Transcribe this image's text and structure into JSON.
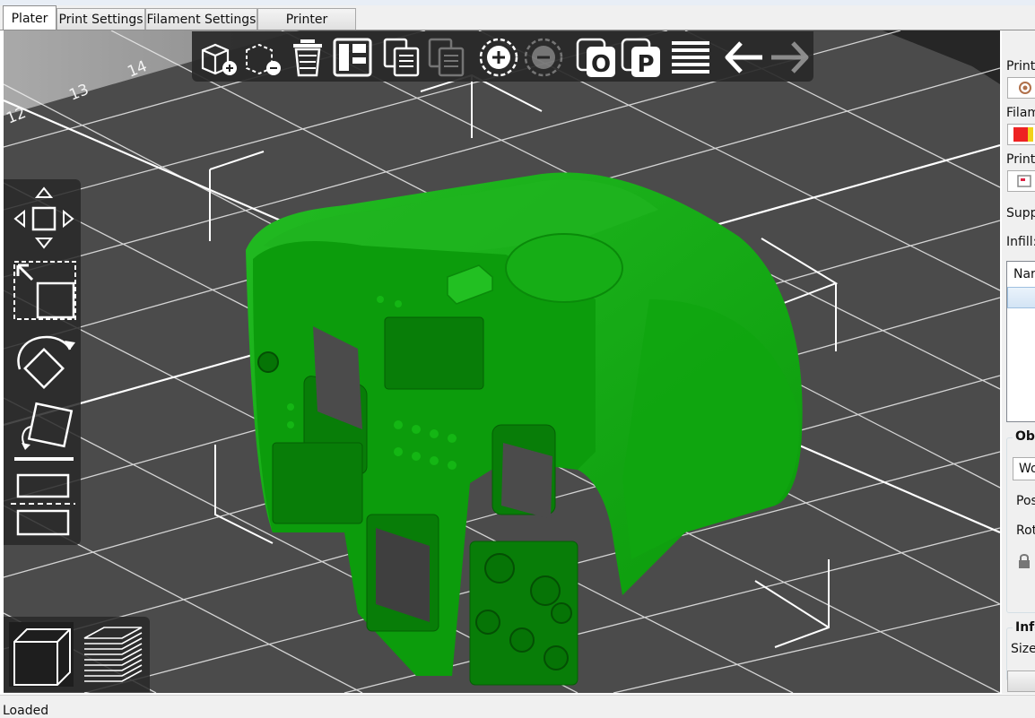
{
  "tabs": [
    {
      "label": "Plater",
      "active": true
    },
    {
      "label": "Print Settings",
      "active": false
    },
    {
      "label": "Filament Settings",
      "active": false
    },
    {
      "label": "Printer Settings",
      "active": false
    }
  ],
  "bed": {
    "grid_labels": [
      "14",
      "13",
      "12"
    ]
  },
  "toolbar": {
    "buttons": [
      {
        "icon": "add-icon",
        "enabled": true
      },
      {
        "icon": "delete-icon",
        "enabled": true
      },
      {
        "icon": "delete-all-icon",
        "enabled": true
      },
      {
        "icon": "arrange-icon",
        "enabled": true
      },
      {
        "icon": "copy-icon",
        "enabled": true
      },
      {
        "icon": "paste-icon",
        "enabled": false
      },
      {
        "icon": "add-instance-icon",
        "enabled": true
      },
      {
        "icon": "remove-instance-icon",
        "enabled": false
      },
      {
        "icon": "split-objects-icon",
        "enabled": true
      },
      {
        "icon": "split-parts-icon",
        "enabled": true
      },
      {
        "icon": "layers-editing-icon",
        "enabled": true
      },
      {
        "icon": "undo-icon",
        "enabled": true
      },
      {
        "icon": "redo-icon",
        "enabled": false
      }
    ],
    "split_objects_letter": "O",
    "split_parts_letter": "P"
  },
  "gizmos": [
    "move-icon",
    "scale-icon",
    "rotate-icon",
    "place-on-face-icon",
    "cut-icon"
  ],
  "view_toolbar": [
    "3d-view-icon",
    "preview-layers-icon"
  ],
  "sidebar": {
    "print_label": "Print",
    "filament_label": "Filam",
    "printer_label": "Printe",
    "supports_label": "Supp",
    "infill_label": "Infill:",
    "list_header": "Nar",
    "object_group_title": "Ob",
    "world_combo": "Wo",
    "position_label": "Pos",
    "rotation_label": "Rot",
    "info_group_title": "Info",
    "size_label": "Size",
    "filament_colors": [
      "#ee2222",
      "#f2d21a"
    ]
  },
  "model": {
    "color": "#0ea10e",
    "shadow": "#087a08",
    "highlight": "#27c227"
  },
  "status": {
    "text": "Loaded"
  }
}
